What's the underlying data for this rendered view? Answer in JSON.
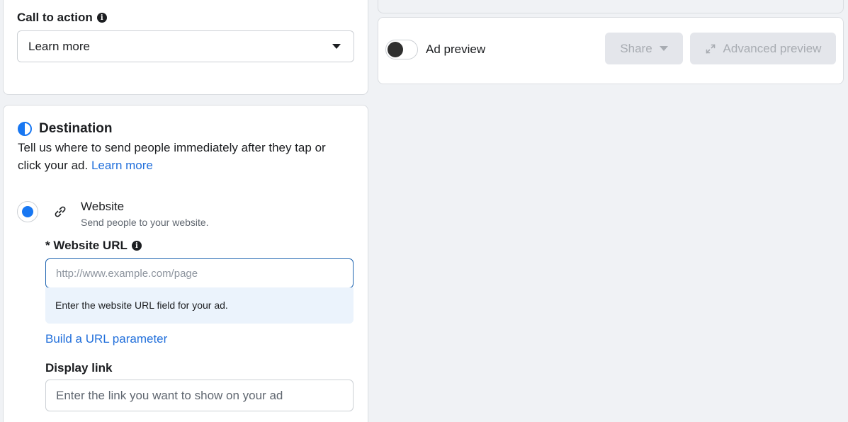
{
  "cta": {
    "label": "Call to action",
    "value": "Learn more"
  },
  "destination": {
    "title": "Destination",
    "description": "Tell us where to send people immediately after they tap or click your ad.",
    "learn_more": "Learn more",
    "option": {
      "title": "Website",
      "subtitle": "Send people to your website.",
      "selected": true
    },
    "website_url": {
      "label": "* Website URL",
      "placeholder": "http://www.example.com/page",
      "value": "",
      "hint": "Enter the website URL field for your ad."
    },
    "build_param_link": "Build a URL parameter",
    "display_link": {
      "label": "Display link",
      "placeholder": "Enter the link you want to show on your ad"
    }
  },
  "preview": {
    "toggle_label": "Ad preview",
    "toggle_on": false,
    "share_label": "Share",
    "advanced_label": "Advanced preview"
  },
  "colors": {
    "accent": "#1877f2",
    "link": "#216fdb",
    "hint_bg": "#ebf3fc",
    "disabled_bg": "#e4e6eb"
  }
}
